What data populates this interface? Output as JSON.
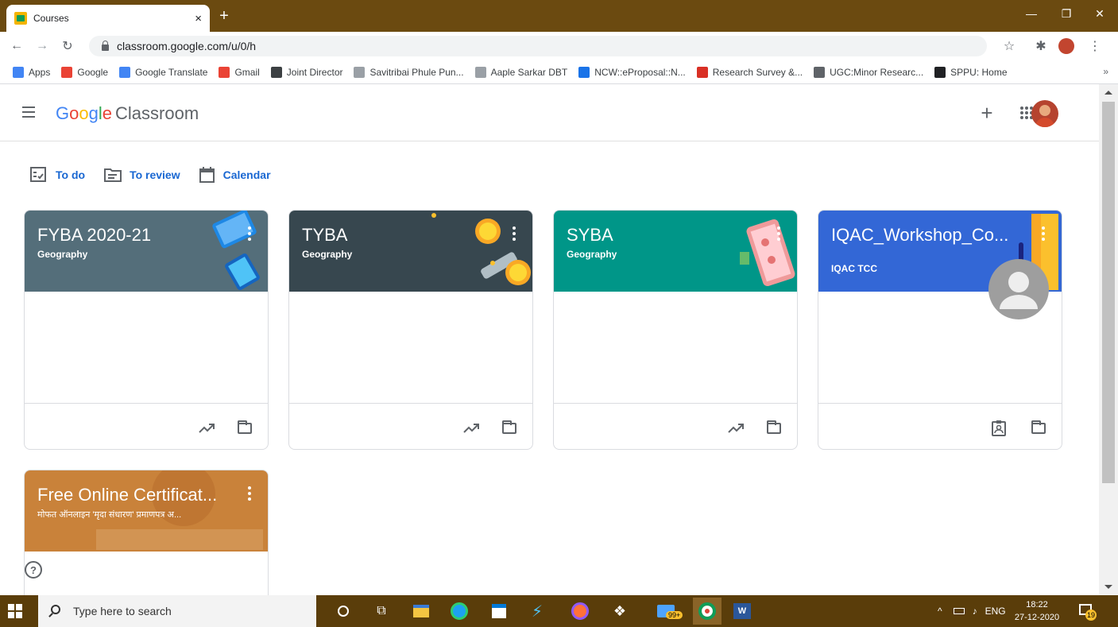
{
  "browser": {
    "tab_title": "Courses",
    "tab_close": "×",
    "new_tab": "+",
    "url": "classroom.google.com/u/0/h",
    "bookmarks": [
      {
        "label": "Apps",
        "color": "#4285f4"
      },
      {
        "label": "Google",
        "color": "#ea4335"
      },
      {
        "label": "Google Translate",
        "color": "#4285f4"
      },
      {
        "label": "Gmail",
        "color": "#ea4335"
      },
      {
        "label": "Joint Director",
        "color": "#3c4043"
      },
      {
        "label": "Savitribai Phule Pun...",
        "color": "#9aa0a6"
      },
      {
        "label": "Aaple Sarkar DBT",
        "color": "#9aa0a6"
      },
      {
        "label": "NCW::eProposal::N...",
        "color": "#1a73e8"
      },
      {
        "label": "Research Survey &...",
        "color": "#d93025"
      },
      {
        "label": "UGC:Minor Researc...",
        "color": "#5f6368"
      },
      {
        "label": "SPPU: Home",
        "color": "#202124"
      }
    ],
    "bookmarks_more": "»"
  },
  "app": {
    "logo_word": [
      "G",
      "o",
      "o",
      "g",
      "l",
      "e"
    ],
    "logo_suffix": "Classroom",
    "links": [
      {
        "label": "To do",
        "icon": "todo-icon"
      },
      {
        "label": "To review",
        "icon": "review-icon"
      },
      {
        "label": "Calendar",
        "icon": "calendar-icon"
      }
    ],
    "courses": [
      {
        "title": "FYBA 2020-21",
        "subtitle": "Geography",
        "color": "#546e7a"
      },
      {
        "title": "TYBA",
        "subtitle": "Geography",
        "color": "#37474f"
      },
      {
        "title": "SYBA",
        "subtitle": "Geography",
        "color": "#009688"
      },
      {
        "title": "IQAC_Workshop_Co...",
        "subtitle": "IQAC TCC",
        "color": "#3367d6"
      },
      {
        "title": "Free Online Certificat...",
        "subtitle": "मोफत ऑनलाइन 'मृदा संधारण' प्रमाणपत्र अ...",
        "color": "#c9823a"
      }
    ],
    "help": "?"
  },
  "taskbar": {
    "search_placeholder": "Type here to search",
    "tray_lang": "ENG",
    "time": "18:22",
    "date": "27-12-2020",
    "store_badge": "99+",
    "notif_count": "19"
  }
}
